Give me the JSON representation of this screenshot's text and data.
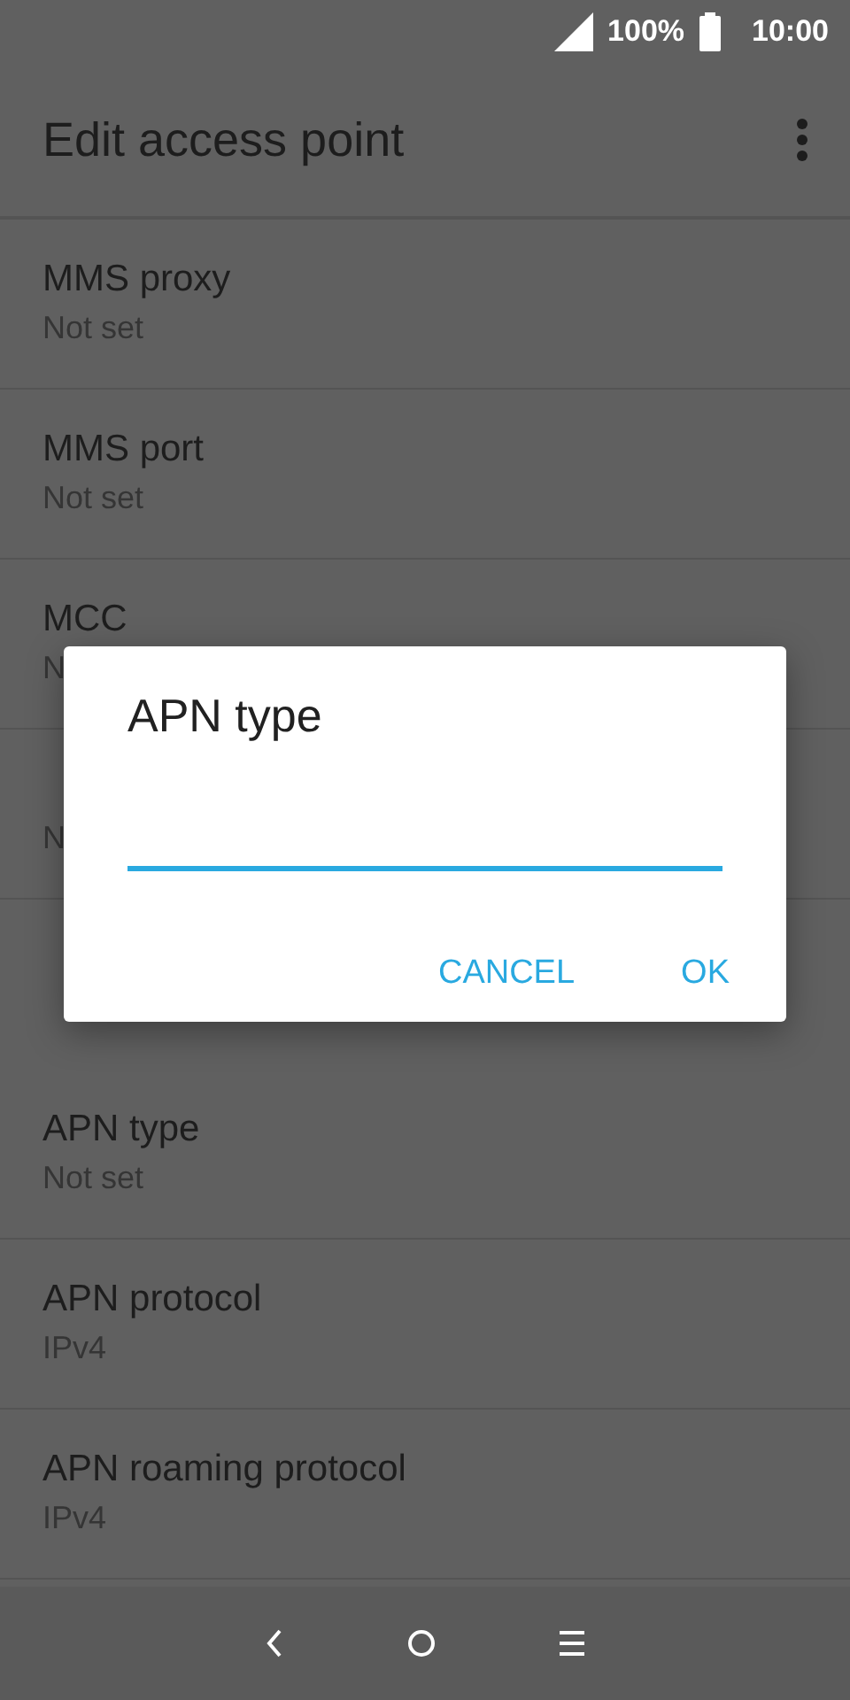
{
  "status_bar": {
    "battery": "100%",
    "time": "10:00"
  },
  "toolbar": {
    "title": "Edit access point"
  },
  "settings": [
    {
      "title": "MMS proxy",
      "summary": "Not set"
    },
    {
      "title": "MMS port",
      "summary": "Not set"
    },
    {
      "title": "MCC",
      "summary": "N"
    },
    {
      "summary": "N"
    }
  ],
  "settings_below_dialog": [
    {
      "title": "APN type",
      "summary": "Not set"
    },
    {
      "title": "APN protocol",
      "summary": "IPv4"
    },
    {
      "title": "APN roaming protocol",
      "summary": "IPv4"
    }
  ],
  "dialog": {
    "title": "APN type",
    "buttons": [
      "CANCEL",
      "OK"
    ]
  }
}
